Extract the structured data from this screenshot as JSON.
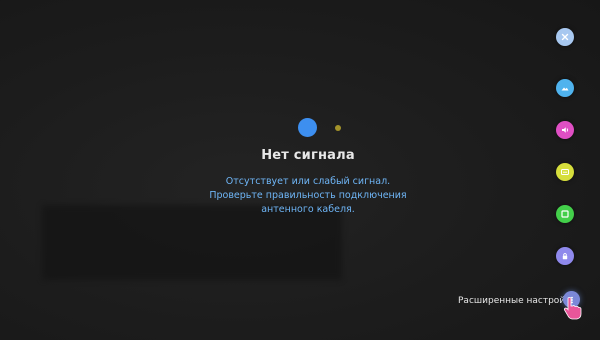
{
  "screen": {
    "title": "Нет сигнала",
    "lines": [
      "Отсутствует или слабый сигнал.",
      "Проверьте правильность подключения",
      "антенного кабеля."
    ]
  },
  "loader": {
    "primary_color": "#3d8ff0",
    "secondary_color": "#a3932a"
  },
  "side_menu": {
    "items": [
      {
        "icon": "close-icon",
        "color": "#a8c8f0"
      },
      {
        "icon": "picture-icon",
        "color": "#4fb3ee"
      },
      {
        "icon": "sound-icon",
        "color": "#e04fc4"
      },
      {
        "icon": "subtitles-icon",
        "color": "#d6de3c"
      },
      {
        "icon": "screen-icon",
        "color": "#43cf4a"
      },
      {
        "icon": "lock-icon",
        "color": "#8f89ec"
      }
    ],
    "advanced_label": "Расширенные настройки",
    "advanced_icon": "more-icon",
    "advanced_color": "#7b88d8"
  }
}
